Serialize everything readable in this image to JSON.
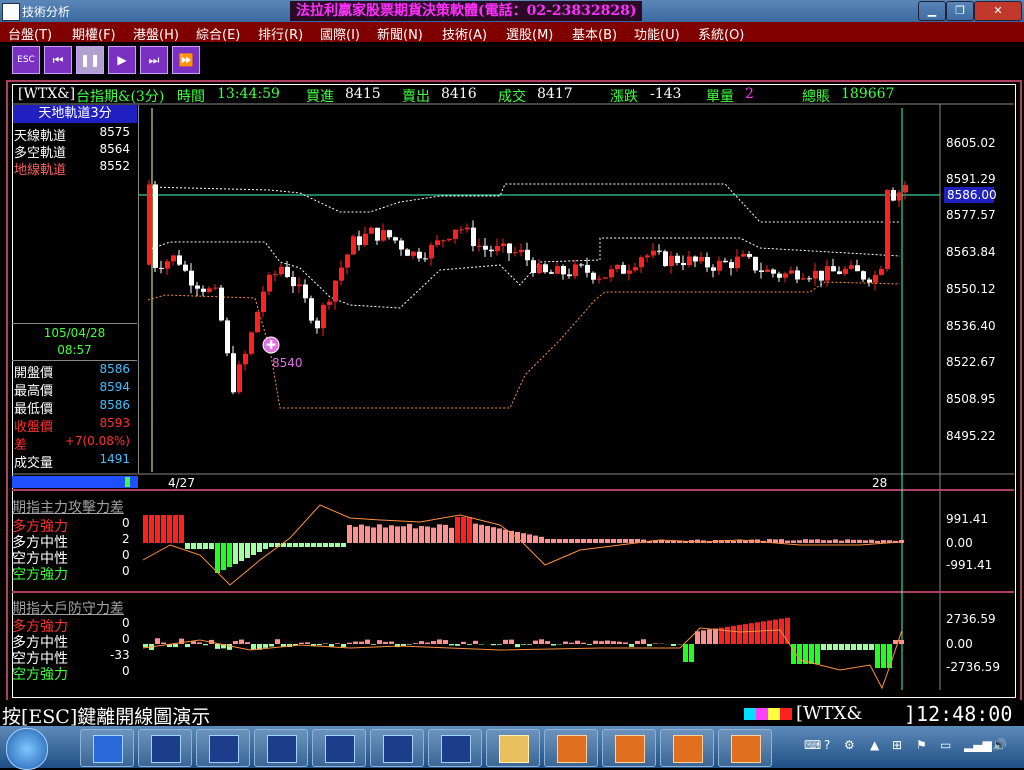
{
  "window": {
    "title": "技術分析",
    "banner": "法拉利贏家股票期貨決策軟體(電話：02-23832828)"
  },
  "menu": [
    "台盤(T)",
    "期權(F)",
    "港盤(H)",
    "綜合(E)",
    "排行(R)",
    "國際(I)",
    "新聞(N)",
    "技術(A)",
    "選股(M)",
    "基本(B)",
    "功能(U)",
    "系統(O)"
  ],
  "toolbar": {
    "esc_label": "ESC"
  },
  "quote": {
    "code": "[WTX&]",
    "name": "台指期&(3分)",
    "time_label": "時間",
    "time": "13:44:59",
    "buy_label": "買進",
    "buy": "8415",
    "sell_label": "賣出",
    "sell": "8416",
    "deal_label": "成交",
    "deal": "8417",
    "change_label": "漲跌",
    "change": "-143",
    "vol_label": "單量",
    "vol": "2",
    "total_label": "總賬",
    "total": "189667"
  },
  "indicator_panel": {
    "title": "天地軌道3分",
    "items": [
      {
        "label": "天線軌道",
        "value": "8575",
        "color": "#ffffff"
      },
      {
        "label": "多空軌道",
        "value": "8564",
        "color": "#ffffff"
      },
      {
        "label": "地線軌道",
        "value": "8552",
        "color": "#ff6060"
      }
    ]
  },
  "bar_info": {
    "date": "105/04/28",
    "time": "08:57",
    "items": [
      {
        "label": "開盤價",
        "value": "8586",
        "lcolor": "#ffffff",
        "vcolor": "#40c0ff"
      },
      {
        "label": "最高價",
        "value": "8594",
        "lcolor": "#ffffff",
        "vcolor": "#40c0ff"
      },
      {
        "label": "最低價",
        "value": "8586",
        "lcolor": "#ffffff",
        "vcolor": "#40c0ff"
      },
      {
        "label": "收盤價",
        "value": "8593",
        "lcolor": "#ff3030",
        "vcolor": "#ff3030"
      },
      {
        "label": "差",
        "value": "+7(0.08%)",
        "lcolor": "#ff3030",
        "vcolor": "#ff3030"
      },
      {
        "label": "成交量",
        "value": "1491",
        "lcolor": "#ffffff",
        "vcolor": "#40c0ff"
      }
    ]
  },
  "main_chart": {
    "y_ticks": [
      "8605.02",
      "8591.29",
      "8577.57",
      "8563.84",
      "8550.12",
      "8536.40",
      "8522.67",
      "8508.95",
      "8495.22"
    ],
    "current_price_label": "8586.00",
    "annotation": "8540",
    "x_labels": [
      "4/27",
      "28"
    ]
  },
  "sub1": {
    "title": "期指主力攻擊力差",
    "items": [
      {
        "label": "多方強力",
        "value": "0",
        "color": "#ff3030"
      },
      {
        "label": "多方中性",
        "value": "2",
        "color": "#ffffff"
      },
      {
        "label": "空方中性",
        "value": "0",
        "color": "#ffffff"
      },
      {
        "label": "空方強力",
        "value": "0",
        "color": "#40ff40"
      }
    ],
    "y_ticks": [
      "991.41",
      "0.00",
      "-991.41"
    ]
  },
  "sub2": {
    "title": "期指大戶防守力差",
    "items": [
      {
        "label": "多方強力",
        "value": "0",
        "color": "#ff3030"
      },
      {
        "label": "多方中性",
        "value": "0",
        "color": "#ffffff"
      },
      {
        "label": "空方中性",
        "value": "-33",
        "color": "#ffffff"
      },
      {
        "label": "空方強力",
        "value": "0",
        "color": "#40ff40"
      }
    ],
    "y_ticks": [
      "2736.59",
      "0.00",
      "-2736.59"
    ]
  },
  "status": {
    "hint": "按[ESC]鍵離開線圖演示",
    "code": "[WTX&",
    "time": "]12:48:00"
  },
  "colors": {
    "up": "#ff2020",
    "down": "#ffffff",
    "frame": "#b04060"
  }
}
